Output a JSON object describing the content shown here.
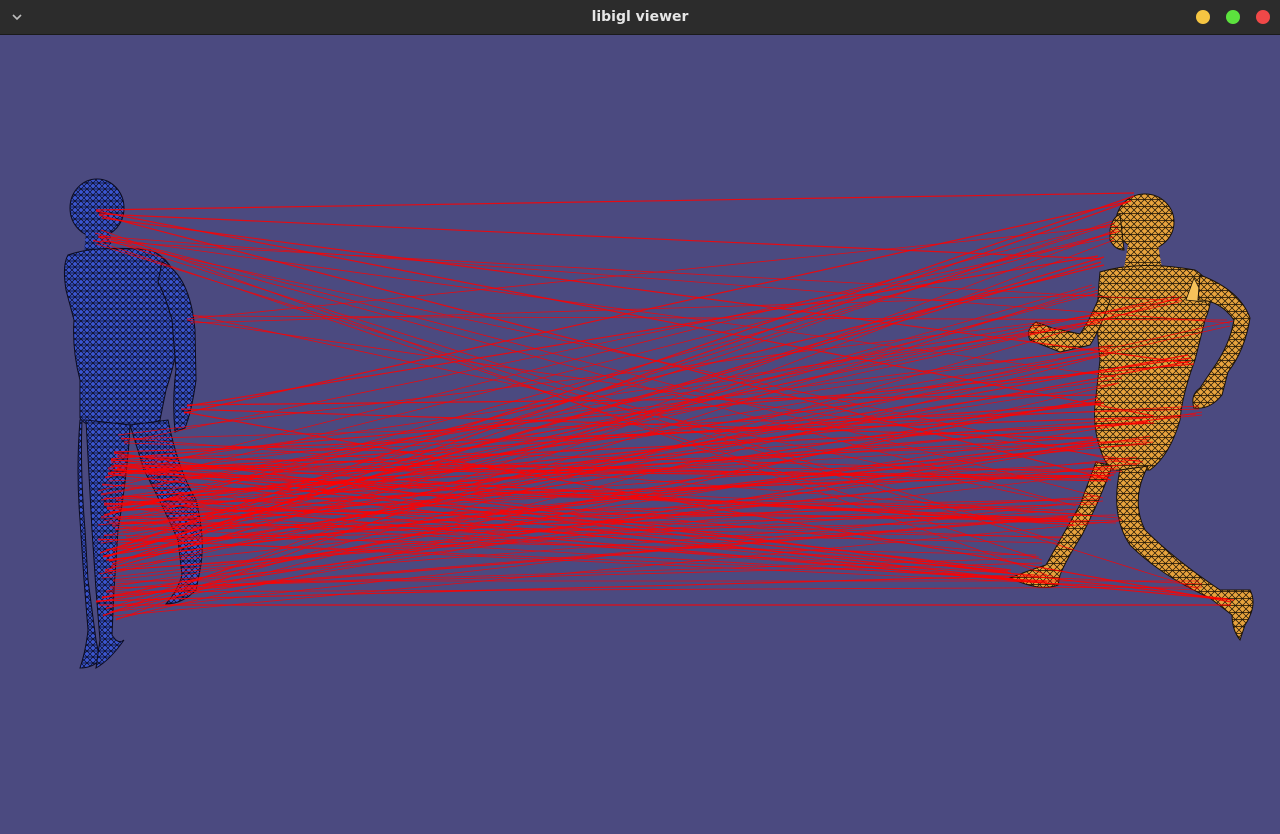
{
  "window": {
    "title": "libigl viewer",
    "controls": {
      "minimize_color": "#f5c542",
      "maximize_color": "#5ce23e",
      "close_color": "#f04848"
    }
  },
  "viewport": {
    "background": "#4b4a80",
    "meshes": [
      {
        "name": "source-mesh",
        "fill": "#3a55d0",
        "wire": "#0b0b20"
      },
      {
        "name": "target-mesh",
        "fill": "#e7a33d",
        "wire": "#1b1205"
      }
    ],
    "correspondence_color": "#ff0000"
  }
}
